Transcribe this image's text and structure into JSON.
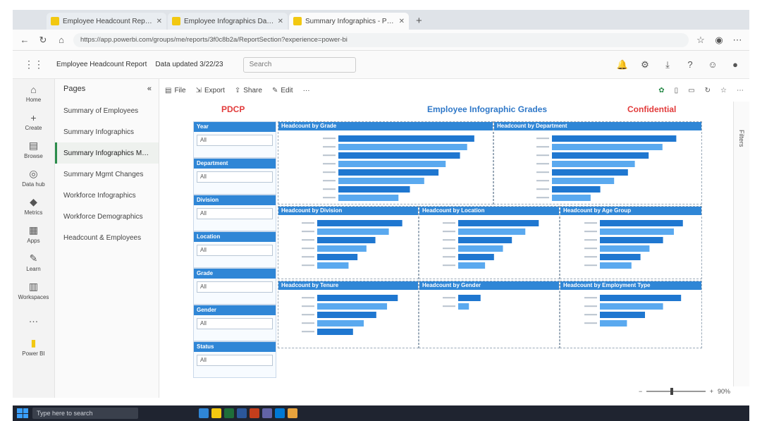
{
  "browser": {
    "tabs": [
      {
        "label": "Employee Headcount Report",
        "active": false
      },
      {
        "label": "Employee Infographics Dashboard",
        "active": false
      },
      {
        "label": "Summary Infographics - Power BI",
        "active": true
      }
    ],
    "new_tab": "+",
    "url": "https://app.powerbi.com/groups/me/reports/3f0c8b2a/ReportSection?experience=power-bi"
  },
  "header": {
    "crumb": "Employee Headcount Report",
    "crumb2": "Data updated 3/22/23",
    "search_placeholder": "Search"
  },
  "rail": [
    {
      "icon": "home-icon",
      "glyph": "⌂",
      "label": "Home"
    },
    {
      "icon": "create-icon",
      "glyph": "+",
      "label": "Create"
    },
    {
      "icon": "browse-icon",
      "glyph": "▤",
      "label": "Browse"
    },
    {
      "icon": "data-hub-icon",
      "glyph": "◎",
      "label": "Data hub"
    },
    {
      "icon": "metrics-icon",
      "glyph": "◆",
      "label": "Metrics"
    },
    {
      "icon": "apps-icon",
      "glyph": "▦",
      "label": "Apps"
    },
    {
      "icon": "learn-icon",
      "glyph": "✎",
      "label": "Learn"
    },
    {
      "icon": "workspaces-icon",
      "glyph": "▥",
      "label": "Workspaces"
    },
    {
      "icon": "more-icon",
      "glyph": "…",
      "label": ""
    },
    {
      "icon": "power-bi-icon",
      "glyph": "▮",
      "label": "Power BI"
    }
  ],
  "pages": {
    "title": "Pages",
    "items": [
      {
        "label": "Summary of Employees",
        "selected": false
      },
      {
        "label": "Summary Infographics",
        "selected": false
      },
      {
        "label": "Summary Infographics Mgmt",
        "selected": true
      },
      {
        "label": "Summary Mgmt Changes",
        "selected": false
      },
      {
        "label": "Workforce Infographics",
        "selected": false
      },
      {
        "label": "Workforce Demographics",
        "selected": false
      },
      {
        "label": "Headcount & Employees",
        "selected": false
      }
    ]
  },
  "toolbar": {
    "file": "File",
    "export": "Export",
    "share": "Share",
    "edit": "Edit",
    "more": "···"
  },
  "canvas": {
    "left_label": "PDCP",
    "title": "Employee Infographic Grades",
    "right_label": "Confidential",
    "slicers": [
      {
        "title": "Year",
        "value": "All"
      },
      {
        "title": "Department",
        "value": "All"
      },
      {
        "title": "Division",
        "value": "All"
      },
      {
        "title": "Location",
        "value": "All"
      },
      {
        "title": "Grade",
        "value": "All"
      },
      {
        "title": "Gender",
        "value": "All"
      },
      {
        "title": "Status",
        "value": "All"
      }
    ]
  },
  "charts": [
    {
      "title": "Headcount by Grade",
      "bars": [
        0.95,
        0.9,
        0.85,
        0.75,
        0.7,
        0.6,
        0.5,
        0.42
      ]
    },
    {
      "title": "Headcount by Department",
      "bars": [
        0.9,
        0.8,
        0.7,
        0.6,
        0.55,
        0.45,
        0.35,
        0.28
      ]
    },
    {
      "title": "Headcount by Division",
      "bars": [
        0.95,
        0.8,
        0.65,
        0.55,
        0.45,
        0.35
      ]
    },
    {
      "title": "Headcount by Location",
      "bars": [
        0.9,
        0.75,
        0.6,
        0.5,
        0.4,
        0.3
      ]
    },
    {
      "title": "Headcount by Age Group",
      "bars": [
        0.92,
        0.82,
        0.7,
        0.55,
        0.45,
        0.35
      ]
    },
    {
      "title": "Headcount by Tenure",
      "bars": [
        0.9,
        0.78,
        0.66,
        0.52,
        0.4
      ]
    },
    {
      "title": "Headcount by Gender",
      "bars": [
        0.25,
        0.12
      ]
    },
    {
      "title": "Headcount by Employment Type",
      "bars": [
        0.9,
        0.7,
        0.5,
        0.3
      ]
    }
  ],
  "zoom": {
    "value": "90%"
  },
  "right_pane": {
    "label": "Filters"
  },
  "taskbar": {
    "search": "Type here to search"
  },
  "colors": {
    "accent": "#2f86d6",
    "bar": "#1f77d0",
    "bar_light": "#5aa9ef",
    "alert": "#e23b3b"
  }
}
